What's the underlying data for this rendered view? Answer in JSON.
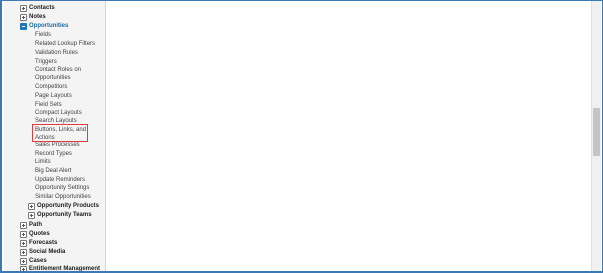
{
  "sidebar": {
    "top_categories": [
      {
        "label": "Contacts",
        "state": "collapsed"
      },
      {
        "label": "Notes",
        "state": "collapsed"
      },
      {
        "label": "Opportunities",
        "state": "expanded"
      }
    ],
    "opportunities_children": [
      "Fields",
      "Related Lookup Filters",
      "Validation Rules",
      "Triggers",
      "Contact Roles on Opportunities",
      "Competitors",
      "Page Layouts",
      "Field Sets",
      "Compact Layouts",
      "Search Layouts",
      "Buttons, Links, and Actions",
      "Sales Processes",
      "Record Types",
      "Limits",
      "Big Deal Alert",
      "Update Reminders",
      "Opportunity Settings",
      "Similar Opportunities"
    ],
    "opportunities_subgroups": [
      "Opportunity Products",
      "Opportunity Teams"
    ],
    "bottom_categories": [
      "Path",
      "Quotes",
      "Forecasts",
      "Social Media",
      "Cases",
      "Entitlement Management"
    ],
    "highlighted_item": "Buttons, Links, and Actions",
    "accent_color": "#1b6ca8",
    "highlight_color": "#e03a3a"
  }
}
